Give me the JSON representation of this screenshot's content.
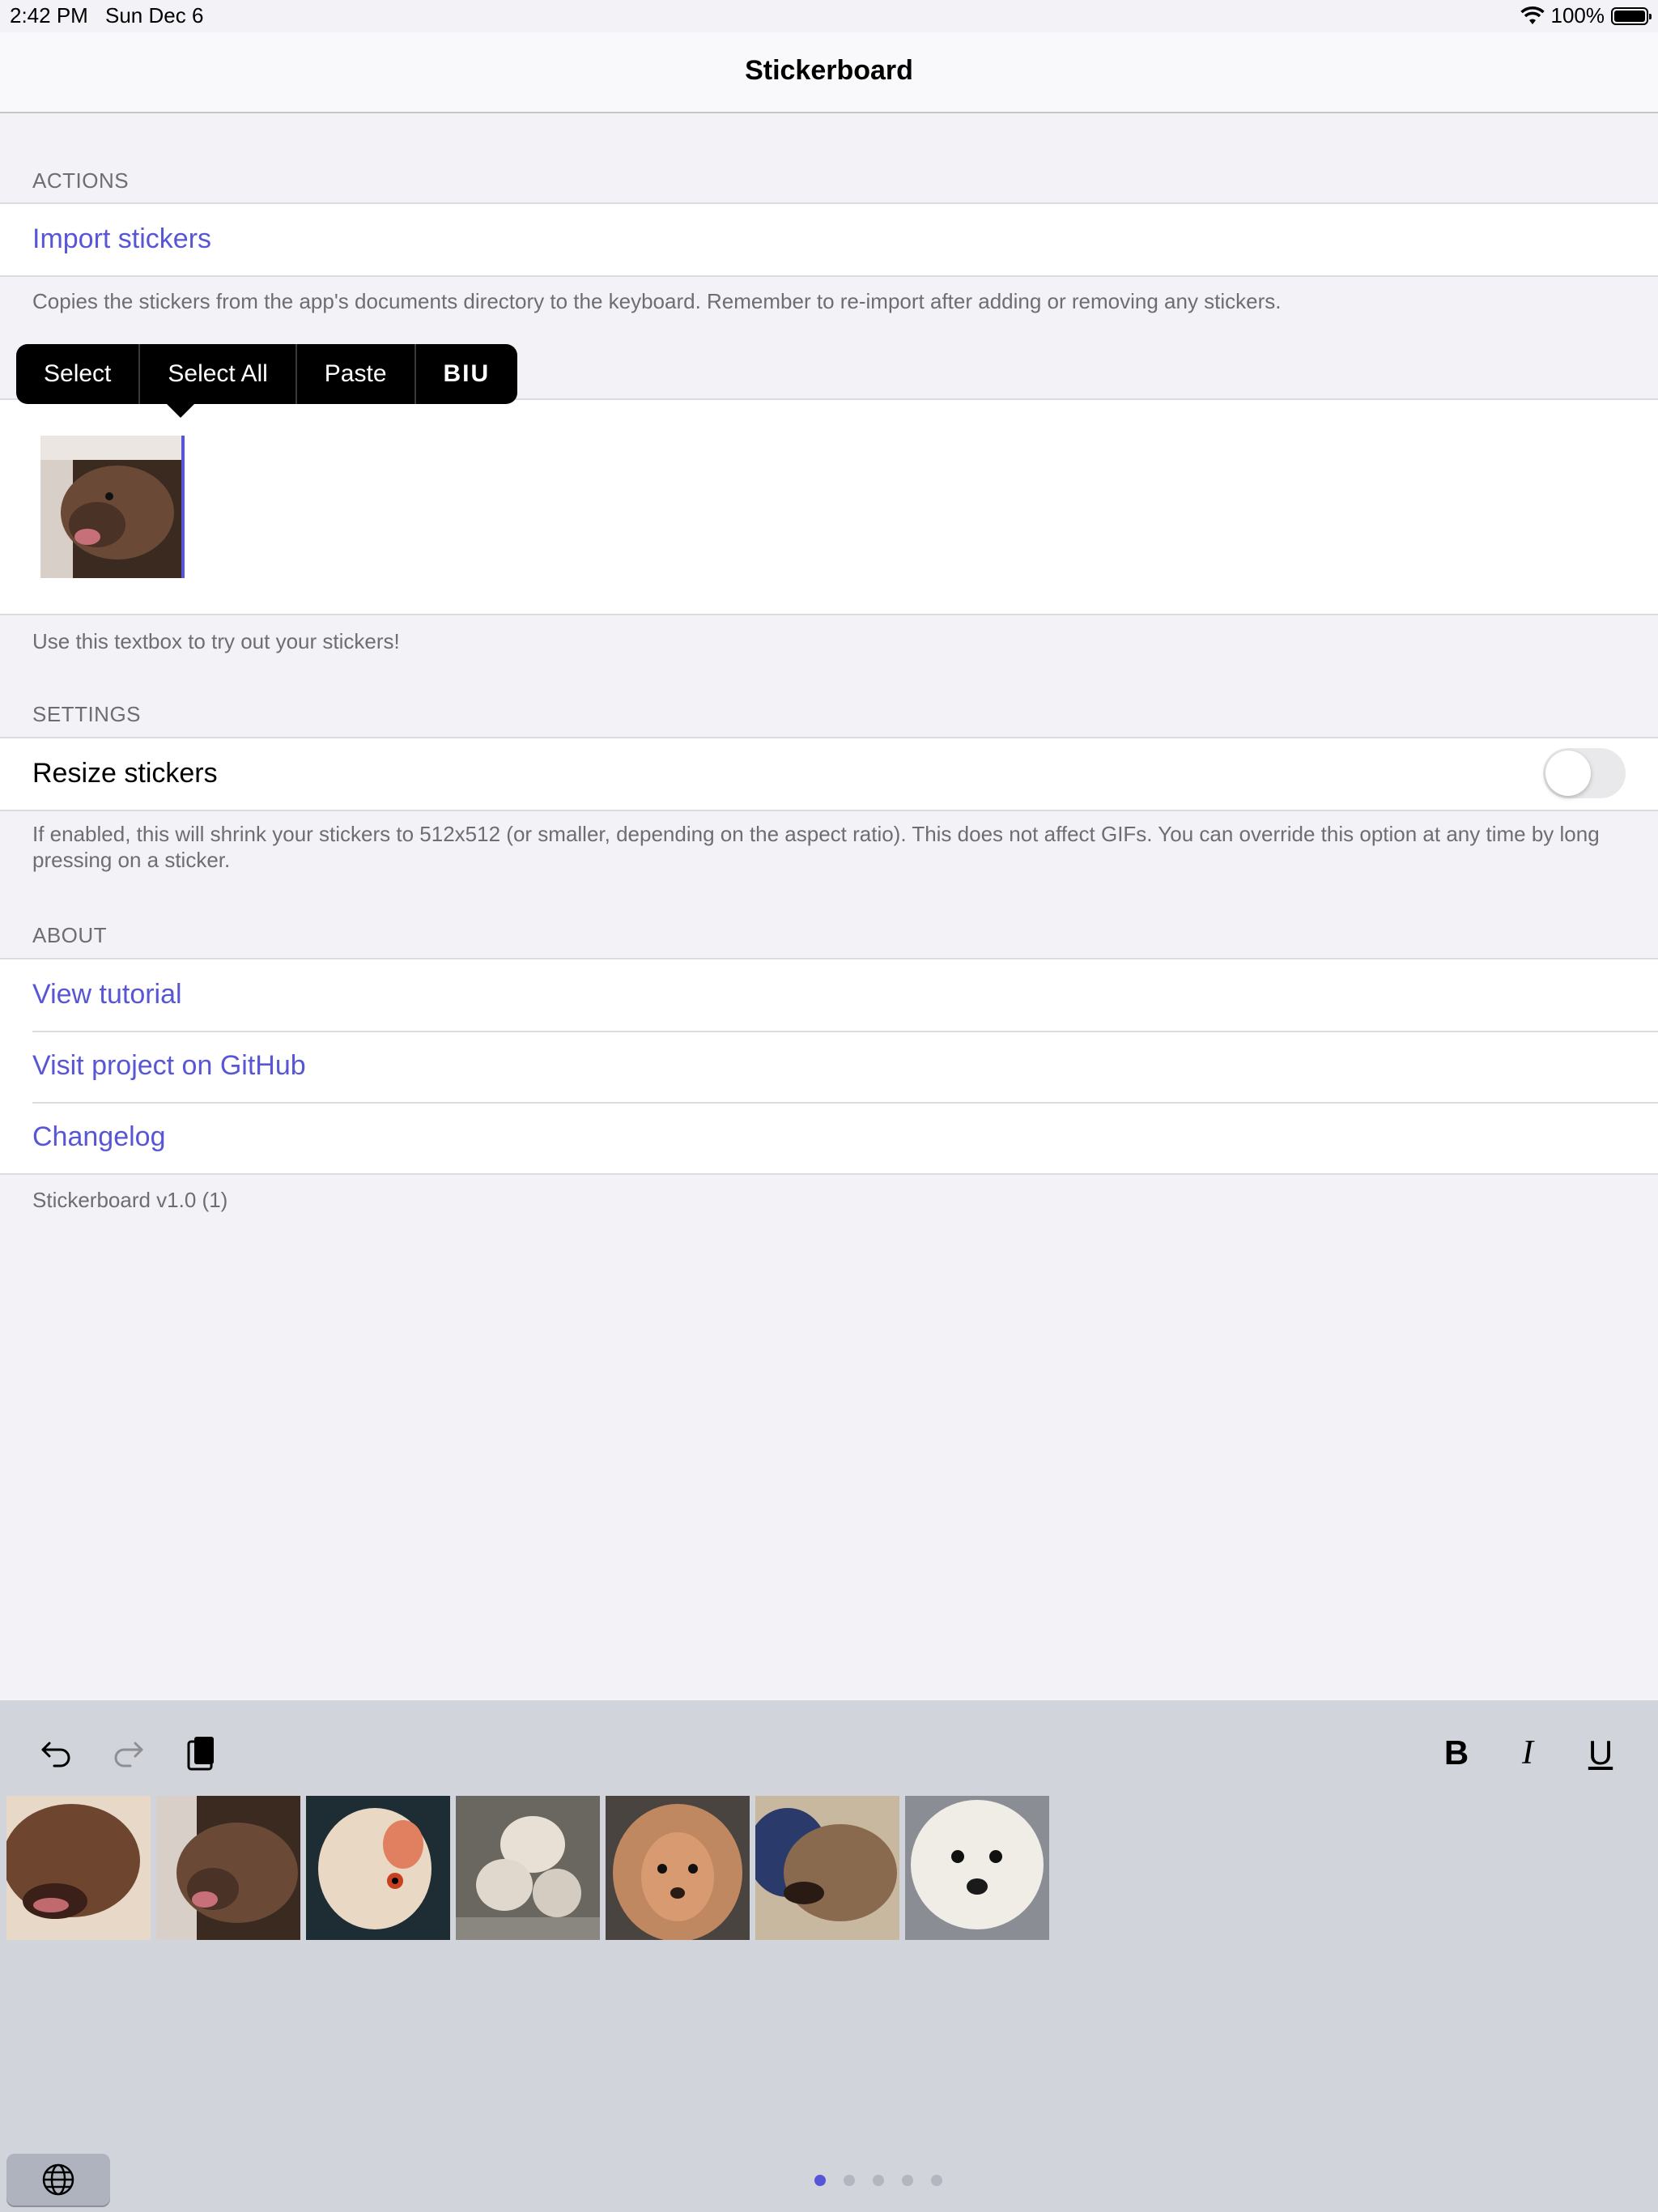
{
  "status_bar": {
    "time": "2:42 PM",
    "date": "Sun Dec 6",
    "battery": "100%"
  },
  "nav": {
    "title": "Stickerboard"
  },
  "actions": {
    "header": "ACTIONS",
    "import_label": "Import stickers",
    "footer": "Copies the stickers from the app's documents directory to the keyboard. Remember to re-import after adding or removing any stickers."
  },
  "edit_menu": {
    "select": "Select",
    "select_all": "Select All",
    "paste": "Paste",
    "format": "BIU"
  },
  "textbox": {
    "footer": "Use this textbox to try out your stickers!"
  },
  "settings": {
    "header": "SETTINGS",
    "resize_label": "Resize stickers",
    "resize_enabled": false,
    "footer": "If enabled, this will shrink your stickers to 512x512 (or smaller, depending on the aspect ratio). This does not affect GIFs. You can override this option at any time by long pressing on a sticker."
  },
  "about": {
    "header": "ABOUT",
    "items": [
      "View tutorial",
      "Visit project on GitHub",
      "Changelog"
    ]
  },
  "version": "Stickerboard v1.0 (1)",
  "keyboard": {
    "format_bold": "B",
    "format_italic": "I",
    "format_underline": "U",
    "page_count": 5,
    "active_page": 1
  },
  "colors": {
    "accent": "#5856d6",
    "background": "#f2f2f7",
    "keyboard_bg": "#d1d4db"
  }
}
